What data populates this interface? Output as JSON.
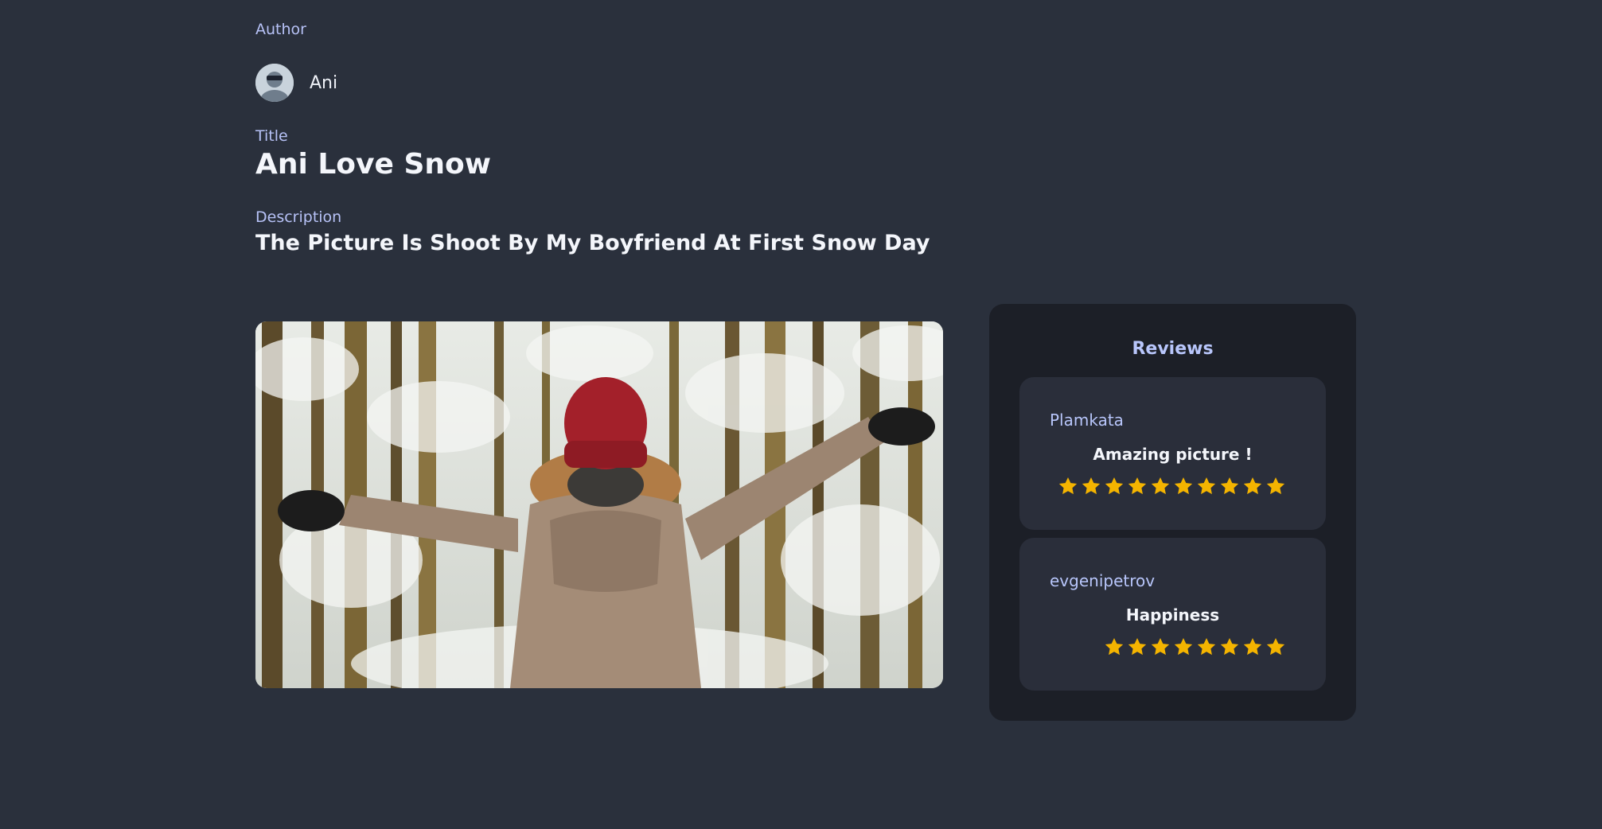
{
  "author": {
    "label": "Author",
    "name": "Ani",
    "avatar_icon": "user-avatar-icon"
  },
  "title": {
    "label": "Title",
    "value": "Ani Love Snow"
  },
  "description": {
    "label": "Description",
    "value": "The Picture Is Shoot By My Boyfriend At First Snow Day"
  },
  "photo": {
    "icon": "snow-forest-photo"
  },
  "reviews": {
    "title": "Reviews",
    "items": [
      {
        "user": "Plamkata",
        "text": "Amazing picture !",
        "rating": 10
      },
      {
        "user": "evgenipetrov",
        "text": "Happiness",
        "rating": 8
      }
    ]
  },
  "colors": {
    "background": "#2a303c",
    "panel": "#1c1f27",
    "card": "#2a2e3a",
    "accent": "#b8c6fb",
    "star": "#f4b400"
  }
}
